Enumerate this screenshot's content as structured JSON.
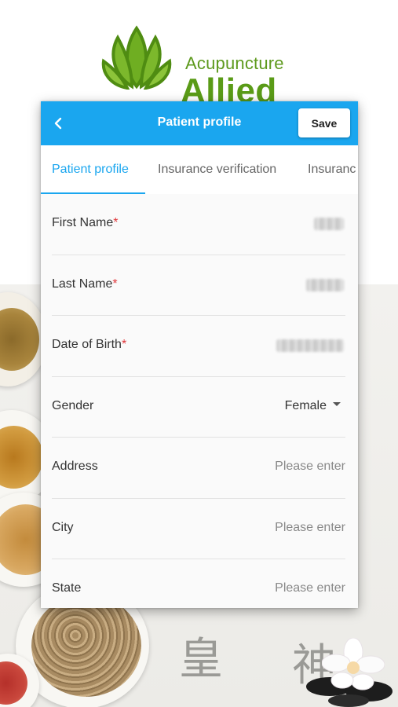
{
  "brand": {
    "name_top": "Acupuncture",
    "name_bottom": "Allied",
    "color": "#5a9b17"
  },
  "header": {
    "back_icon": "chevron-left-icon",
    "title": "Patient profile",
    "save_label": "Save",
    "bar_color": "#1aa6ef"
  },
  "tabs": [
    {
      "label": "Patient profile",
      "active": true
    },
    {
      "label": "Insurance verification",
      "active": false
    },
    {
      "label": "Insuranc",
      "active": false
    }
  ],
  "form": {
    "fields": [
      {
        "label": "First Name",
        "required": "*",
        "value": ""
      },
      {
        "label": "Last Name",
        "required": "*",
        "value": ""
      },
      {
        "label": "Date of Birth",
        "required": "*",
        "value": ""
      },
      {
        "label": "Gender",
        "value": "Female"
      },
      {
        "label": "Address",
        "placeholder": "Please enter"
      },
      {
        "label": "City",
        "placeholder": "Please enter"
      },
      {
        "label": "State",
        "placeholder": "Please enter"
      }
    ]
  },
  "background": {
    "calligraphy": [
      "皇",
      "神"
    ]
  }
}
